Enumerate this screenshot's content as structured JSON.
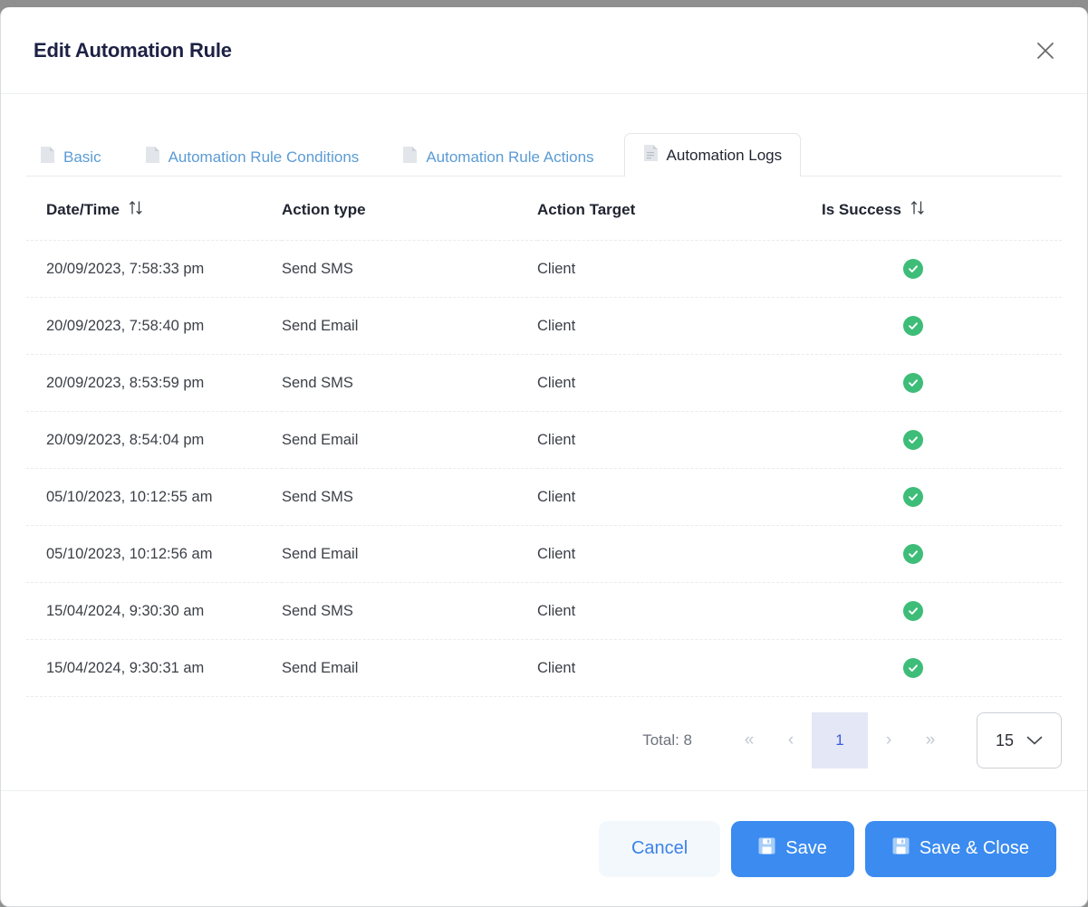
{
  "dialog": {
    "title": "Edit Automation Rule",
    "close_label": "×"
  },
  "tabs": [
    {
      "label": "Basic",
      "icon": "document-icon",
      "active": false
    },
    {
      "label": "Automation Rule Conditions",
      "icon": "document-icon",
      "active": false
    },
    {
      "label": "Automation Rule Actions",
      "icon": "document-icon",
      "active": false
    },
    {
      "label": "Automation Logs",
      "icon": "document-lines-icon",
      "active": true
    }
  ],
  "table": {
    "columns": [
      {
        "label": "Date/Time",
        "sortable": true
      },
      {
        "label": "Action type",
        "sortable": false
      },
      {
        "label": "Action Target",
        "sortable": false
      },
      {
        "label": "Is Success",
        "sortable": true
      }
    ],
    "rows": [
      {
        "datetime": "20/09/2023, 7:58:33 pm",
        "action_type": "Send SMS",
        "action_target": "Client",
        "is_success": true
      },
      {
        "datetime": "20/09/2023, 7:58:40 pm",
        "action_type": "Send Email",
        "action_target": "Client",
        "is_success": true
      },
      {
        "datetime": "20/09/2023, 8:53:59 pm",
        "action_type": "Send SMS",
        "action_target": "Client",
        "is_success": true
      },
      {
        "datetime": "20/09/2023, 8:54:04 pm",
        "action_type": "Send Email",
        "action_target": "Client",
        "is_success": true
      },
      {
        "datetime": "05/10/2023, 10:12:55 am",
        "action_type": "Send SMS",
        "action_target": "Client",
        "is_success": true
      },
      {
        "datetime": "05/10/2023, 10:12:56 am",
        "action_type": "Send Email",
        "action_target": "Client",
        "is_success": true
      },
      {
        "datetime": "15/04/2024, 9:30:30 am",
        "action_type": "Send SMS",
        "action_target": "Client",
        "is_success": true
      },
      {
        "datetime": "15/04/2024, 9:30:31 am",
        "action_type": "Send Email",
        "action_target": "Client",
        "is_success": true
      }
    ]
  },
  "pagination": {
    "total_label": "Total: 8",
    "first_label": "«",
    "prev_label": "‹",
    "current_page": "1",
    "next_label": "›",
    "last_label": "»",
    "page_size": "15",
    "page_size_options": [
      "15"
    ]
  },
  "footer": {
    "cancel_label": "Cancel",
    "save_label": "Save",
    "save_close_label": "Save & Close"
  },
  "colors": {
    "accent_blue": "#3b8bf0",
    "tab_link_blue": "#5b9bd5",
    "success_green": "#3dbd78",
    "page_active_bg": "#e4e7f6",
    "page_active_text": "#3b5bdb",
    "title_navy": "#1d2144"
  }
}
